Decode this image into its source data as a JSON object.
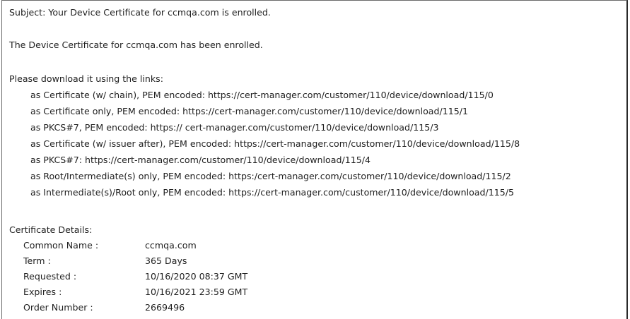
{
  "email": {
    "subject_line": "Subject: Your Device Certificate for ccmqa.com is enrolled.",
    "enrolled_line": "The Device Certificate for ccmqa.com has been enrolled.",
    "download_intro": "Please download it using the links:",
    "links": [
      {
        "label": "as Certificate (w/ chain), PEM encoded: ",
        "url": "https://cert-manager.com/customer/110/device/download/115/0"
      },
      {
        "label": "as Certificate only, PEM encoded: ",
        "url": "https://cert-manager.com/customer/110/device/download/115/1"
      },
      {
        "label": "as PKCS#7, PEM encoded: ",
        "url": "https:// cert-manager.com/customer/110/device/download/115/3"
      },
      {
        "label": "as Certificate (w/ issuer after), PEM encoded: ",
        "url": "https://cert-manager.com/customer/110/device/download/115/8"
      },
      {
        "label": "as PKCS#7: ",
        "url": "https://cert-manager.com/customer/110/device/download/115/4"
      },
      {
        "label": "as Root/Intermediate(s) only, PEM encoded: ",
        "url": "https:/cert-manager.com/customer/110/device/download/115/2"
      },
      {
        "label": "as Intermediate(s)/Root only, PEM encoded: ",
        "url": "https://cert-manager.com/customer/110/device/download/115/5"
      }
    ],
    "details_title": "Certificate Details:",
    "details": [
      {
        "label": "Common Name :",
        "value": "ccmqa.com"
      },
      {
        "label": "Term :",
        "value": "365 Days"
      },
      {
        "label": "Requested :",
        "value": "10/16/2020 08:37 GMT"
      },
      {
        "label": "Expires :",
        "value": "10/16/2021 23:59 GMT"
      },
      {
        "label": "Order Number :",
        "value": "2669496"
      }
    ]
  }
}
